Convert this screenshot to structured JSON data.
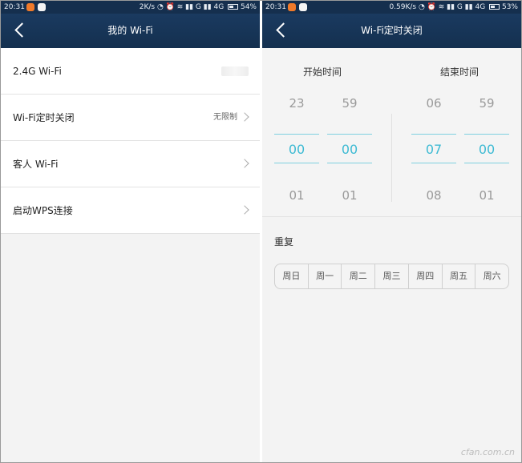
{
  "left": {
    "status": {
      "time": "20:31",
      "right": "2K/s ◔ ⏰ ≋ ▮▮ G ▮▮ 4G",
      "battery": "54%",
      "battery_level": 0.54
    },
    "header": {
      "title": "我的 Wi-Fi"
    },
    "items": [
      {
        "label": "2.4G Wi-Fi",
        "value": ""
      },
      {
        "label": "Wi-Fi定时关闭",
        "value": "无限制"
      },
      {
        "label": "客人 Wi-Fi",
        "value": ""
      },
      {
        "label": "启动WPS连接",
        "value": ""
      }
    ]
  },
  "right": {
    "status": {
      "time": "20:31",
      "right": "0.59K/s ◔ ⏰ ≋ ▮▮ G ▮▮ 4G",
      "battery": "53%",
      "battery_level": 0.53
    },
    "header": {
      "title": "Wi-Fi定时关闭"
    },
    "start": {
      "label": "开始时间",
      "hour": {
        "prev": "23",
        "current": "00",
        "next": "01"
      },
      "minute": {
        "prev": "59",
        "current": "00",
        "next": "01"
      }
    },
    "end": {
      "label": "结束时间",
      "hour": {
        "prev": "06",
        "current": "07",
        "next": "08"
      },
      "minute": {
        "prev": "59",
        "current": "00",
        "next": "01"
      }
    },
    "repeat": {
      "label": "重复",
      "days": [
        "周日",
        "周一",
        "周二",
        "周三",
        "周四",
        "周五",
        "周六"
      ]
    }
  },
  "watermark": "cfan.com.cn",
  "colors": {
    "header_bg": "#14304f",
    "accent": "#3dbad3",
    "screen_bg": "#f3f3f3"
  }
}
